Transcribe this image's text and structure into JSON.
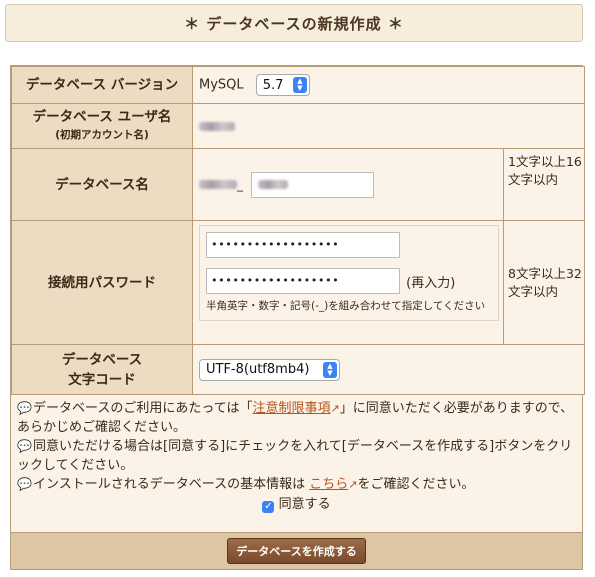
{
  "title": "＊ データベースの新規作成 ＊",
  "rows": {
    "version": {
      "label": "データベース バージョン",
      "db_type": "MySQL",
      "version_value": "5.7"
    },
    "user": {
      "label": "データベース ユーザ名",
      "sub_label": "(初期アカウント名)"
    },
    "dbname": {
      "label": "データベース名",
      "prefix_sep": "_",
      "hint": "1文字以上16文字以内"
    },
    "password": {
      "label": "接続用パスワード",
      "value": "••••••••••••••••••",
      "confirm_value": "••••••••••••••••••",
      "reenter": "(再入力)",
      "help": "半角英字・数字・記号(-_)を組み合わせて指定してください",
      "hint": "8文字以上32文字以内"
    },
    "charset": {
      "label_line1": "データベース",
      "label_line2": "文字コード",
      "value": "UTF-8(utf8mb4)"
    }
  },
  "notes": {
    "n1_pre": "データベースのご利用にあたっては「",
    "n1_link": "注意制限事項",
    "n1_post": "」に同意いただく必要がありますので、",
    "n1_line2": "あらかじめご確認ください。",
    "n2": "同意いただける場合は[同意する]にチェックを入れて[データベースを作成する]ボタンをクリックしてください。",
    "n3_pre": "インストールされるデータベースの基本情報は",
    "n3_link": "こちら",
    "n3_post": "をご確認ください。",
    "agree_label": "同意する",
    "agree_checked": true
  },
  "submit_label": "データベースを作成する",
  "colors": {
    "header": "#ecdcc2",
    "cell": "#fcf3e8",
    "link": "#b3541e",
    "accent": "#3b82f6"
  }
}
